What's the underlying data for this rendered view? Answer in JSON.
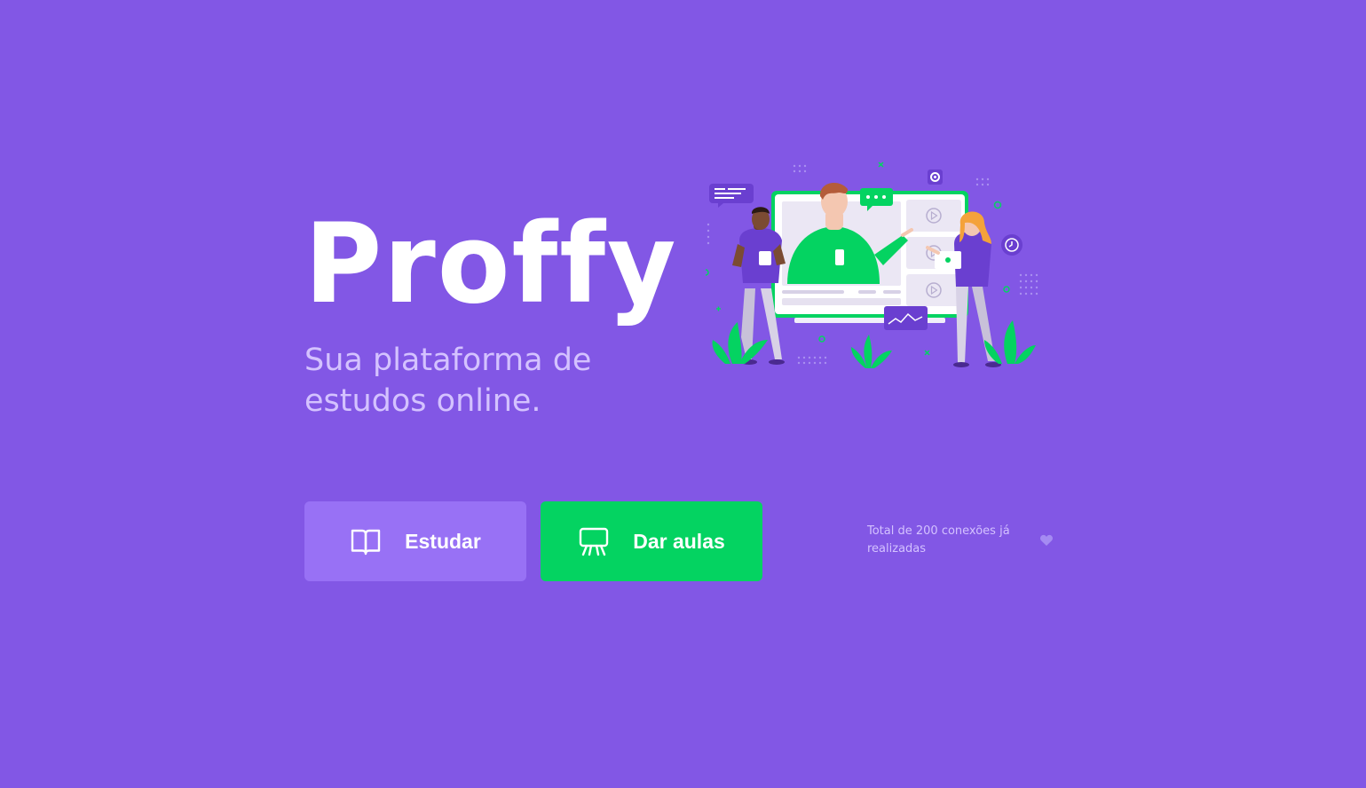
{
  "brand": {
    "logo_text": "Proffy",
    "tagline_line1": "Sua plataforma de",
    "tagline_line2": "estudos online."
  },
  "actions": {
    "study_label": "Estudar",
    "study_icon": "book-open-icon",
    "teach_label": "Dar aulas",
    "teach_icon": "presentation-board-icon"
  },
  "footer": {
    "connections_text": "Total de 200 conexões já realizadas",
    "connections_icon": "heart-icon"
  },
  "colors": {
    "background": "#8257e5",
    "study_button": "#9871f5",
    "teach_button": "#04d361",
    "tagline": "#d4c2ff",
    "text_white": "#ffffff"
  }
}
